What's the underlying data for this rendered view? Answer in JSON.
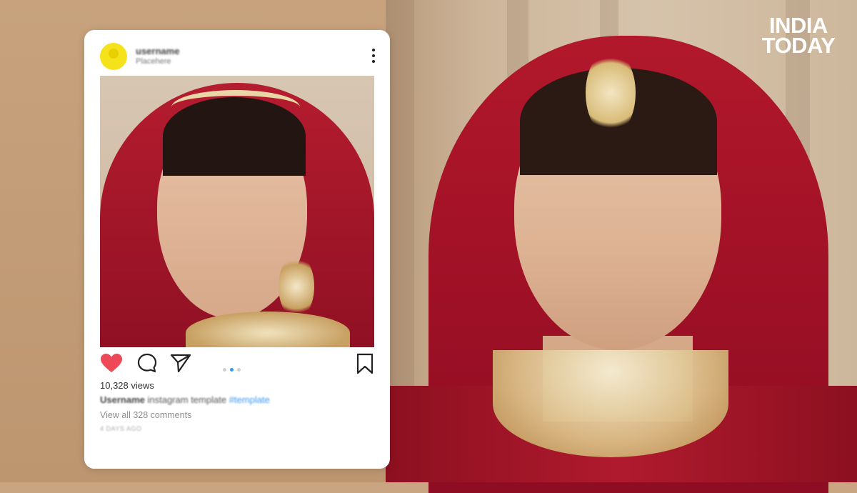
{
  "logo": {
    "line1": "INDIA",
    "line2": "TODAY"
  },
  "post": {
    "username": "username",
    "location": "Placehere",
    "views": "10,328 views",
    "caption_user": "Username",
    "caption_text": "instagram template",
    "caption_tag": "#template",
    "comments_link": "View all 328 comments",
    "time_ago": "4 DAYS AGO",
    "carousel_total": 3,
    "carousel_active": 2
  },
  "colors": {
    "background": "#c9a582",
    "heart": "#ed4956",
    "accent": "#3897f0",
    "avatar": "#f6e21a",
    "veil": "#b2182b"
  },
  "icons": [
    "heart-icon",
    "comment-icon",
    "share-icon",
    "bookmark-icon",
    "more-options-icon"
  ]
}
